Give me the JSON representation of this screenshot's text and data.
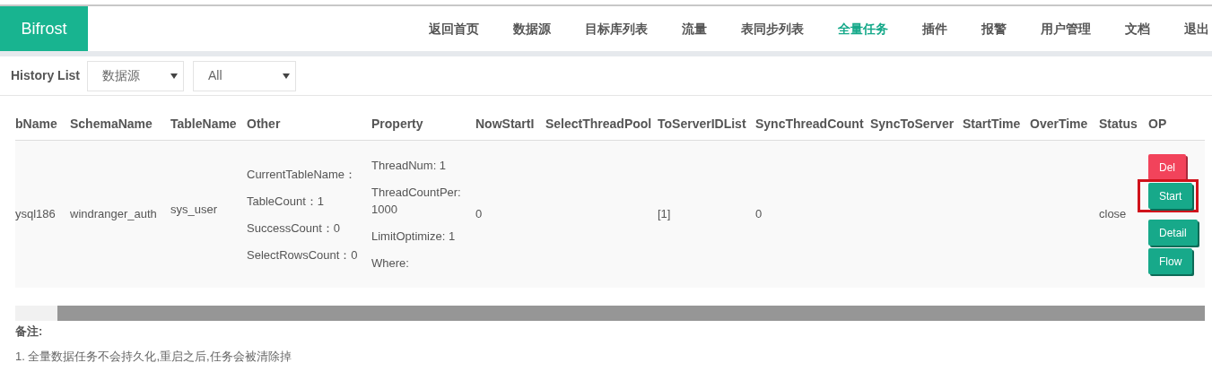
{
  "brand": "Bifrost",
  "nav": [
    {
      "label": "返回首页",
      "selected": false
    },
    {
      "label": "数据源",
      "selected": false
    },
    {
      "label": "目标库列表",
      "selected": false
    },
    {
      "label": "流量",
      "selected": false
    },
    {
      "label": "表同步列表",
      "selected": false
    },
    {
      "label": "全量任务",
      "selected": true
    },
    {
      "label": "插件",
      "selected": false
    },
    {
      "label": "报警",
      "selected": false
    },
    {
      "label": "用户管理",
      "selected": false
    },
    {
      "label": "文档",
      "selected": false
    },
    {
      "label": "退出",
      "selected": false
    }
  ],
  "filter": {
    "label": "History List",
    "selects": [
      {
        "value": "数据源"
      },
      {
        "value": "All"
      }
    ]
  },
  "table": {
    "columns": [
      "bName",
      "SchemaName",
      "TableName",
      "Other",
      "Property",
      "NowStartI",
      "SelectThreadPool",
      "ToServerIDList",
      "SyncThreadCount",
      "SyncToServer",
      "StartTime",
      "OverTime",
      "Status",
      "OP"
    ],
    "rows": [
      {
        "cells": [
          {
            "kind": "text",
            "text": "ysql186"
          },
          {
            "kind": "text",
            "text": "windranger_auth"
          },
          {
            "kind": "text",
            "text": "sys_user"
          },
          {
            "kind": "lines",
            "lines": [
              "CurrentTableName：",
              "TableCount：1",
              "SuccessCount：0",
              "SelectRowsCount：0"
            ]
          },
          {
            "kind": "lines",
            "lines": [
              "ThreadNum: 1",
              "ThreadCountPer: 1000",
              "LimitOptimize: 1",
              "Where:"
            ]
          },
          {
            "kind": "text",
            "text": "0"
          },
          {
            "kind": "empty"
          },
          {
            "kind": "text",
            "text": "[1]"
          },
          {
            "kind": "text",
            "text": "0"
          },
          {
            "kind": "empty"
          },
          {
            "kind": "empty"
          },
          {
            "kind": "empty"
          },
          {
            "kind": "text",
            "text": "close"
          },
          {
            "kind": "buttons",
            "buttons": [
              {
                "label": "Del",
                "kind": "danger",
                "highlighted": false
              },
              {
                "label": "Start",
                "kind": "primary",
                "highlighted": true
              },
              {
                "label": "Detail",
                "kind": "primary",
                "highlighted": false
              },
              {
                "label": "Flow",
                "kind": "primary",
                "highlighted": false
              }
            ]
          }
        ]
      }
    ]
  },
  "notes": {
    "title": "备注:",
    "items": [
      "1. 全量数据任务不会持久化,重启之后,任务会被清除掉"
    ]
  }
}
